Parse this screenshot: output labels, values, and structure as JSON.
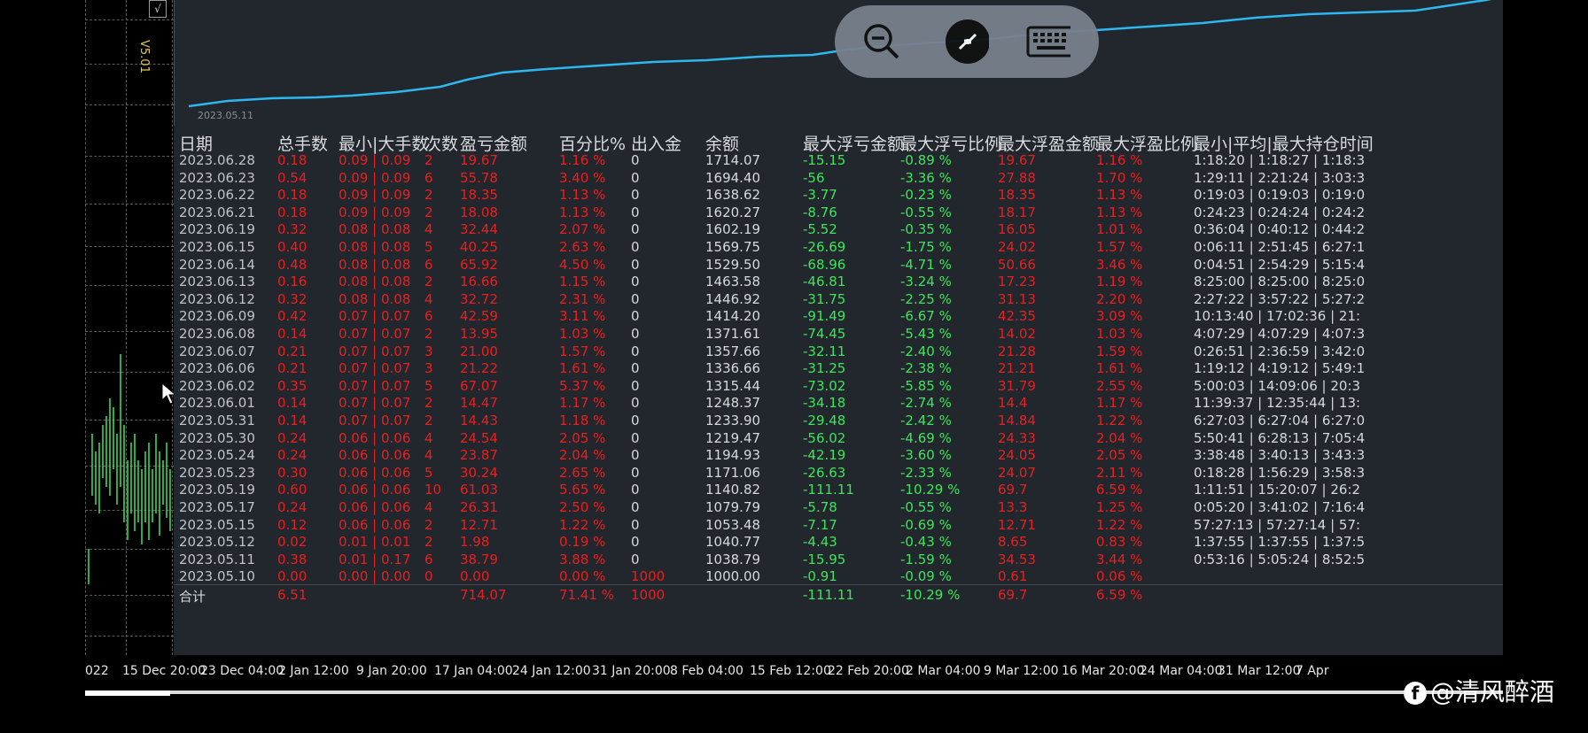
{
  "left_strip": {
    "version": "V5.01",
    "check_mark": "√"
  },
  "chart": {
    "start_date": "2023.05.11"
  },
  "toolbar": {
    "zoom_out": "zoom-out-icon",
    "remote": "remote-connect-icon",
    "keyboard": "keyboard-icon"
  },
  "table": {
    "headers": [
      "日期",
      "总手数",
      "最小|大手数",
      "次数",
      "盈亏金额",
      "百分比%",
      "出入金",
      "余额",
      "最大浮亏金额",
      "最大浮亏比例",
      "最大浮盈金额",
      "最大浮盈比例",
      "最小|平均|最大持仓时间"
    ],
    "rows": [
      [
        "2023.06.28",
        "0.18",
        "0.09 | 0.09",
        "2",
        "19.67",
        "1.16 %",
        "0",
        "1714.07",
        "-15.15",
        "-0.89 %",
        "19.67",
        "1.16 %",
        "1:18:20 | 1:18:27 | 1:18:3"
      ],
      [
        "2023.06.23",
        "0.54",
        "0.09 | 0.09",
        "6",
        "55.78",
        "3.40 %",
        "0",
        "1694.40",
        "-56",
        "-3.36 %",
        "27.88",
        "1.70 %",
        "1:29:11 | 2:21:24 | 3:03:3"
      ],
      [
        "2023.06.22",
        "0.18",
        "0.09 | 0.09",
        "2",
        "18.35",
        "1.13 %",
        "0",
        "1638.62",
        "-3.77",
        "-0.23 %",
        "18.35",
        "1.13 %",
        "0:19:03 | 0:19:03 | 0:19:0"
      ],
      [
        "2023.06.21",
        "0.18",
        "0.09 | 0.09",
        "2",
        "18.08",
        "1.13 %",
        "0",
        "1620.27",
        "-8.76",
        "-0.55 %",
        "18.17",
        "1.13 %",
        "0:24:23 | 0:24:24 | 0:24:2"
      ],
      [
        "2023.06.19",
        "0.32",
        "0.08 | 0.08",
        "4",
        "32.44",
        "2.07 %",
        "0",
        "1602.19",
        "-5.52",
        "-0.35 %",
        "16.05",
        "1.01 %",
        "0:36:04 | 0:40:12 | 0:44:2"
      ],
      [
        "2023.06.15",
        "0.40",
        "0.08 | 0.08",
        "5",
        "40.25",
        "2.63 %",
        "0",
        "1569.75",
        "-26.69",
        "-1.75 %",
        "24.02",
        "1.57 %",
        "0:06:11 | 2:51:45 | 6:27:1"
      ],
      [
        "2023.06.14",
        "0.48",
        "0.08 | 0.08",
        "6",
        "65.92",
        "4.50 %",
        "0",
        "1529.50",
        "-68.96",
        "-4.71 %",
        "50.66",
        "3.46 %",
        "0:04:51 | 2:54:29 | 5:15:4"
      ],
      [
        "2023.06.13",
        "0.16",
        "0.08 | 0.08",
        "2",
        "16.66",
        "1.15 %",
        "0",
        "1463.58",
        "-46.81",
        "-3.24 %",
        "17.23",
        "1.19 %",
        "8:25:00 | 8:25:00 | 8:25:0"
      ],
      [
        "2023.06.12",
        "0.32",
        "0.08 | 0.08",
        "4",
        "32.72",
        "2.31 %",
        "0",
        "1446.92",
        "-31.75",
        "-2.25 %",
        "31.13",
        "2.20 %",
        "2:27:22 | 3:57:22 | 5:27:2"
      ],
      [
        "2023.06.09",
        "0.42",
        "0.07 | 0.07",
        "6",
        "42.59",
        "3.11 %",
        "0",
        "1414.20",
        "-91.49",
        "-6.67 %",
        "42.35",
        "3.09 %",
        "10:13:40 | 17:02:36 | 21:"
      ],
      [
        "2023.06.08",
        "0.14",
        "0.07 | 0.07",
        "2",
        "13.95",
        "1.03 %",
        "0",
        "1371.61",
        "-74.45",
        "-5.43 %",
        "14.02",
        "1.03 %",
        "4:07:29 | 4:07:29 | 4:07:3"
      ],
      [
        "2023.06.07",
        "0.21",
        "0.07 | 0.07",
        "3",
        "21.00",
        "1.57 %",
        "0",
        "1357.66",
        "-32.11",
        "-2.40 %",
        "21.28",
        "1.59 %",
        "0:26:51 | 2:36:59 | 3:42:0"
      ],
      [
        "2023.06.06",
        "0.21",
        "0.07 | 0.07",
        "3",
        "21.22",
        "1.61 %",
        "0",
        "1336.66",
        "-31.25",
        "-2.38 %",
        "21.21",
        "1.61 %",
        "1:19:12 | 4:19:12 | 5:49:1"
      ],
      [
        "2023.06.02",
        "0.35",
        "0.07 | 0.07",
        "5",
        "67.07",
        "5.37 %",
        "0",
        "1315.44",
        "-73.02",
        "-5.85 %",
        "31.79",
        "2.55 %",
        "5:00:03 | 14:09:06 | 20:3"
      ],
      [
        "2023.06.01",
        "0.14",
        "0.07 | 0.07",
        "2",
        "14.47",
        "1.17 %",
        "0",
        "1248.37",
        "-34.18",
        "-2.74 %",
        "14.4",
        "1.17 %",
        "11:39:37 | 12:35:44 | 13:"
      ],
      [
        "2023.05.31",
        "0.14",
        "0.07 | 0.07",
        "2",
        "14.43",
        "1.18 %",
        "0",
        "1233.90",
        "-29.48",
        "-2.42 %",
        "14.84",
        "1.22 %",
        "6:27:03 | 6:27:04 | 6:27:0"
      ],
      [
        "2023.05.30",
        "0.24",
        "0.06 | 0.06",
        "4",
        "24.54",
        "2.05 %",
        "0",
        "1219.47",
        "-56.02",
        "-4.69 %",
        "24.33",
        "2.04 %",
        "5:50:41 | 6:28:13 | 7:05:4"
      ],
      [
        "2023.05.24",
        "0.24",
        "0.06 | 0.06",
        "4",
        "23.87",
        "2.04 %",
        "0",
        "1194.93",
        "-42.19",
        "-3.60 %",
        "24.05",
        "2.05 %",
        "3:38:48 | 3:40:13 | 3:43:3"
      ],
      [
        "2023.05.23",
        "0.30",
        "0.06 | 0.06",
        "5",
        "30.24",
        "2.65 %",
        "0",
        "1171.06",
        "-26.63",
        "-2.33 %",
        "24.07",
        "2.11 %",
        "0:18:28 | 1:56:29 | 3:58:3"
      ],
      [
        "2023.05.19",
        "0.60",
        "0.06 | 0.06",
        "10",
        "61.03",
        "5.65 %",
        "0",
        "1140.82",
        "-111.11",
        "-10.29 %",
        "69.7",
        "6.59 %",
        "1:11:51 | 15:20:07 | 26:2"
      ],
      [
        "2023.05.17",
        "0.24",
        "0.06 | 0.06",
        "4",
        "26.31",
        "2.50 %",
        "0",
        "1079.79",
        "-5.78",
        "-0.55 %",
        "13.3",
        "1.25 %",
        "0:05:20 | 3:41:02 | 7:16:4"
      ],
      [
        "2023.05.15",
        "0.12",
        "0.06 | 0.06",
        "2",
        "12.71",
        "1.22 %",
        "0",
        "1053.48",
        "-7.17",
        "-0.69 %",
        "12.71",
        "1.22 %",
        "57:27:13 | 57:27:14 | 57:"
      ],
      [
        "2023.05.12",
        "0.02",
        "0.01 | 0.01",
        "2",
        "1.98",
        "0.19 %",
        "0",
        "1040.77",
        "-4.43",
        "-0.43 %",
        "8.65",
        "0.83 %",
        "1:37:55 | 1:37:55 | 1:37:5"
      ],
      [
        "2023.05.11",
        "0.38",
        "0.01 | 0.17",
        "6",
        "38.79",
        "3.88 %",
        "0",
        "1038.79",
        "-15.95",
        "-1.59 %",
        "34.53",
        "3.44 %",
        "0:53:16 | 5:05:24 | 8:52:5"
      ],
      [
        "2023.05.10",
        "0.00",
        "0.00 | 0.00",
        "0",
        "0.00",
        "0.00 %",
        "1000",
        "1000.00",
        "-0.91",
        "-0.09 %",
        "0.61",
        "0.06 %",
        ""
      ]
    ],
    "total": [
      "合计",
      "6.51",
      "",
      "",
      "714.07",
      "71.41 %",
      "1000",
      "",
      "-111.11",
      "-10.29 %",
      "69.7",
      "6.59 %",
      ""
    ]
  },
  "time_axis": [
    "022",
    "15 Dec 20:00",
    "23 Dec 04:00",
    "2 Jan 12:00",
    "9 Jan 20:00",
    "17 Jan 04:00",
    "24 Jan 12:00",
    "31 Jan 20:00",
    "8 Feb 04:00",
    "15 Feb 12:00",
    "22 Feb 20:00",
    "2 Mar 04:00",
    "9 Mar 12:00",
    "16 Mar 20:00",
    "24 Mar 04:00",
    "31 Mar 12:00",
    "7 Apr"
  ],
  "watermark": {
    "logo": "f",
    "text": "@清风醉酒"
  }
}
